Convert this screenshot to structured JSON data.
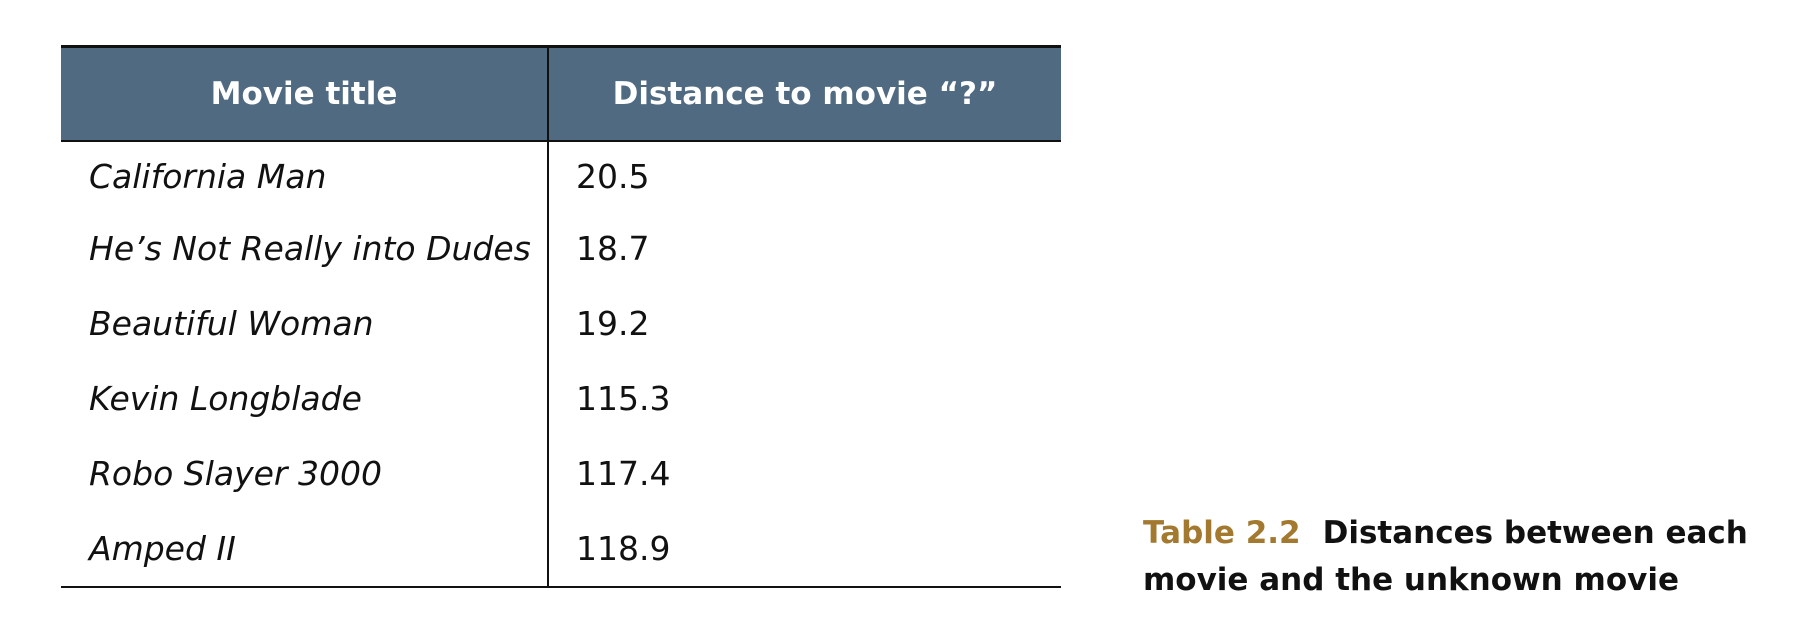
{
  "table": {
    "headers": [
      "Movie title",
      "Distance to movie “?”"
    ],
    "rows": [
      {
        "title": "California Man",
        "distance": "20.5"
      },
      {
        "title": "He’s Not Really into Dudes",
        "distance": "18.7"
      },
      {
        "title": "Beautiful Woman",
        "distance": "19.2"
      },
      {
        "title": "Kevin Longblade",
        "distance": "115.3"
      },
      {
        "title": "Robo Slayer 3000",
        "distance": "117.4"
      },
      {
        "title": "Amped II",
        "distance": "118.9"
      }
    ]
  },
  "caption": {
    "label": "Table 2.2",
    "text": "Distances between each movie and the unknown movie"
  },
  "colors": {
    "header_background": "#506a82",
    "caption_label": "#a2792e"
  }
}
